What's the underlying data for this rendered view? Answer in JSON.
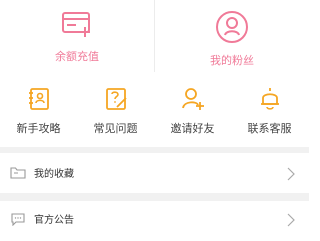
{
  "top_actions": [
    {
      "label": "余额充值",
      "icon": "card-plus-icon"
    },
    {
      "label": "我的粉丝",
      "icon": "user-circle-icon"
    }
  ],
  "quick_links": [
    {
      "label": "新手攻略",
      "icon": "guide-book-icon"
    },
    {
      "label": "常见问题",
      "icon": "question-edit-icon"
    },
    {
      "label": "邀请好友",
      "icon": "invite-user-icon"
    },
    {
      "label": "联系客服",
      "icon": "bell-icon"
    }
  ],
  "menu": [
    {
      "label": "我的收藏",
      "icon": "folder-icon"
    },
    {
      "label": "官方公告",
      "icon": "message-icon"
    }
  ],
  "colors": {
    "pink": "#f07a98",
    "orange": "#f5a623",
    "text": "#333333",
    "divider": "#f1f1f1"
  }
}
